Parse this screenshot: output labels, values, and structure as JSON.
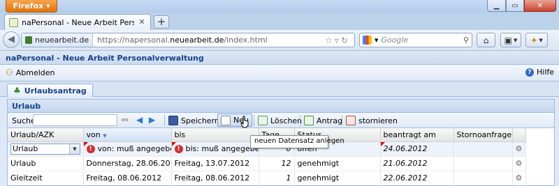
{
  "browser": {
    "menu_button": "Firefox",
    "tab_title": "naPersonal - Neue Arbeit Personalverwal...",
    "new_tab_icon": "plus-icon",
    "site_identity": "neuearbeit.de",
    "url_prefix": "https://napersonal.",
    "url_domain": "neuearbeit.de",
    "url_path": "/index.html",
    "search_engine_icon": "google-icon",
    "search_placeholder": "Google"
  },
  "app": {
    "title": "naPersonal - Neue Arbeit Personalverwaltung",
    "logout_label": "Abmelden",
    "help_label": "Hilfe",
    "main_tab_label": "Urlaubsantrag"
  },
  "panel": {
    "title": "Urlaub",
    "search_label": "Suche",
    "search_value": "",
    "toolbar": {
      "save": "Speichern",
      "new": "Neu",
      "delete": "Löschen",
      "request": "Antrag",
      "cancel": "stornieren"
    },
    "tooltip": "neuen Datensatz anlegen"
  },
  "grid": {
    "columns": [
      "Urlaub/AZK",
      "von",
      "bis",
      "Tage",
      "Status",
      "beantragt am",
      "Stornoanfrage"
    ],
    "sort_column": "von",
    "edit_row": {
      "type": "Urlaub",
      "von_error": "von: muß angegebe...",
      "bis_error": "bis: muß angegebe...",
      "tage": "0",
      "status": "offen",
      "beantragt": "24.06.2012"
    },
    "rows": [
      {
        "type": "Urlaub",
        "von": "Donnerstag, 28.06.2012",
        "bis": "Freitag, 13.07.2012",
        "tage": "12",
        "status": "genehmigt",
        "beantragt": "21.06.2012"
      },
      {
        "type": "Gleitzeit",
        "von": "Freitag, 08.06.2012",
        "bis": "Freitag, 08.06.2012",
        "tage": "1",
        "status": "genehmigt",
        "beantragt": "22.06.2012"
      }
    ]
  },
  "colors": {
    "ext_header_text": "#15428b",
    "panel_border": "#99bbe8",
    "error_red": "#d32f2f",
    "firefox_orange": "#e2720e"
  }
}
